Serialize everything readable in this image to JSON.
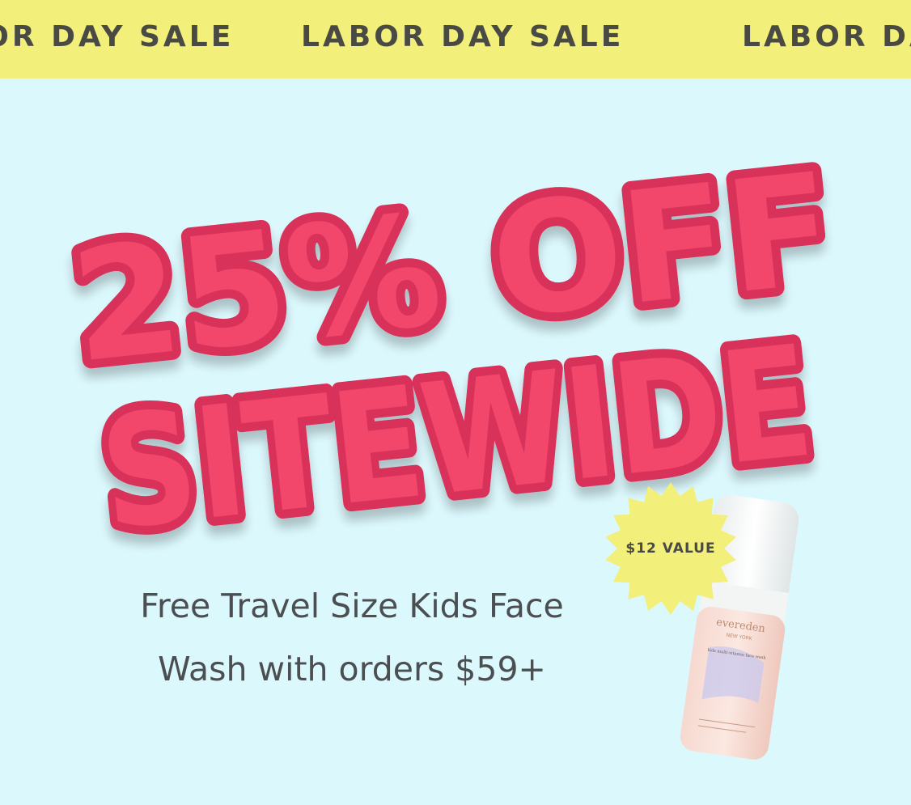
{
  "banner": {
    "items": [
      "LABOR DAY SALE",
      "LABOR DAY SALE",
      "LABOR DAY SALE"
    ]
  },
  "hero": {
    "headline_line1": "25% OFF",
    "headline_line2": "SITEWIDE",
    "headline_color": "#f2476a"
  },
  "badge": {
    "label": "$12 VALUE",
    "color": "#f2ef7b"
  },
  "offer": {
    "line1": "Free Travel Size Kids Face",
    "line2": "Wash with orders $59+"
  },
  "product": {
    "brand": "evereden",
    "subbrand": "NEW YORK",
    "name": "kids multi-vitamin face wash"
  },
  "colors": {
    "background": "#dbf8fd",
    "banner": "#f2ef7b",
    "text": "#4c4f52"
  }
}
